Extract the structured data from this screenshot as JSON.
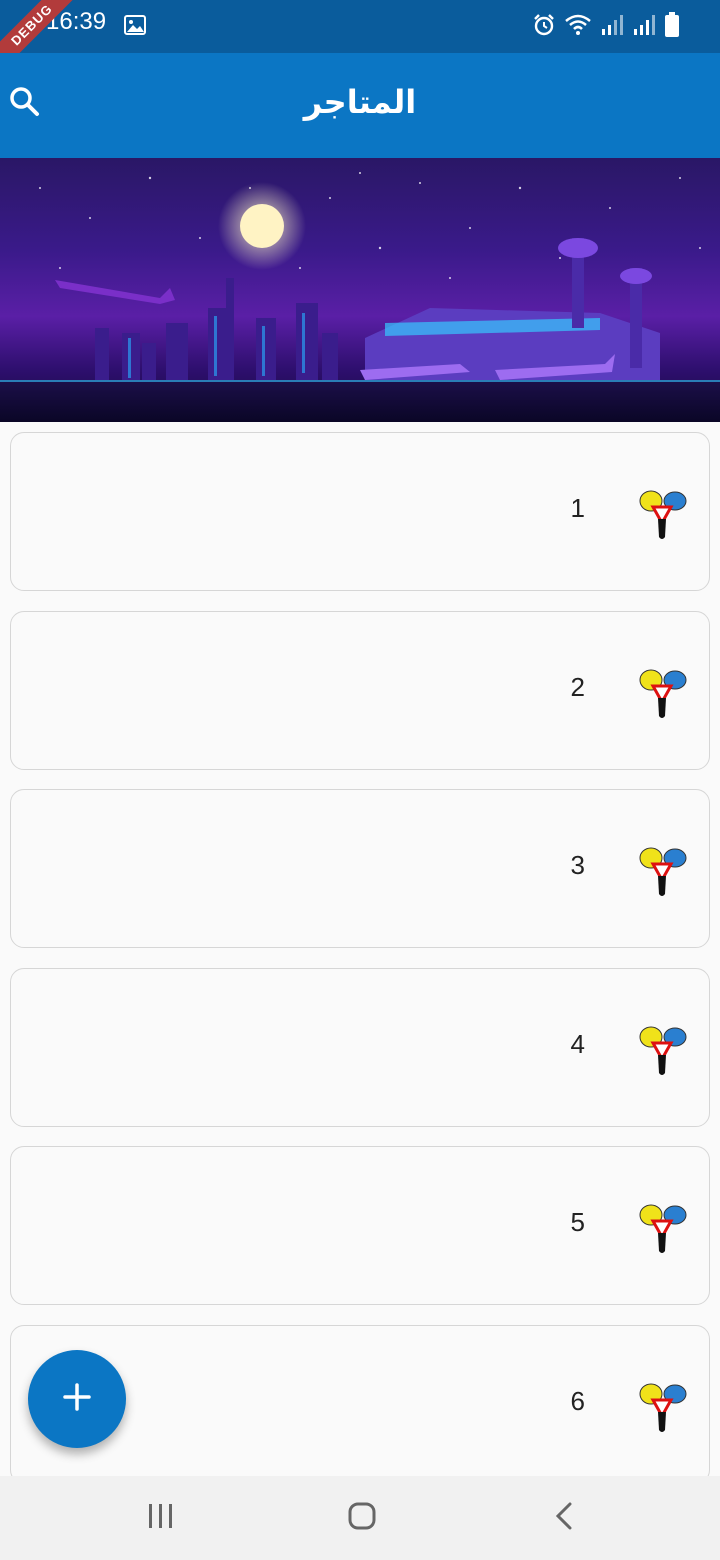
{
  "status_bar": {
    "time": "16:39",
    "debug_label": "DEBUG",
    "icons": [
      "image-icon",
      "alarm-icon",
      "wifi-icon",
      "signal-icon",
      "signal-icon",
      "battery-icon"
    ]
  },
  "app_bar": {
    "title": "المتاجر",
    "search_icon": "search-icon",
    "color": "#0b76c4"
  },
  "banner": {
    "alt": "city-airport-night-illustration"
  },
  "stores": [
    {
      "name": "1",
      "logo": "store-logo-icon"
    },
    {
      "name": "2",
      "logo": "store-logo-icon"
    },
    {
      "name": "3",
      "logo": "store-logo-icon"
    },
    {
      "name": "4",
      "logo": "store-logo-icon"
    },
    {
      "name": "5",
      "logo": "store-logo-icon"
    },
    {
      "name": "6",
      "logo": "store-logo-icon"
    }
  ],
  "fab": {
    "icon": "plus-icon",
    "color": "#0b76c4"
  },
  "nav_bar": {
    "icons": [
      "recent-apps-icon",
      "home-icon",
      "back-icon"
    ]
  }
}
